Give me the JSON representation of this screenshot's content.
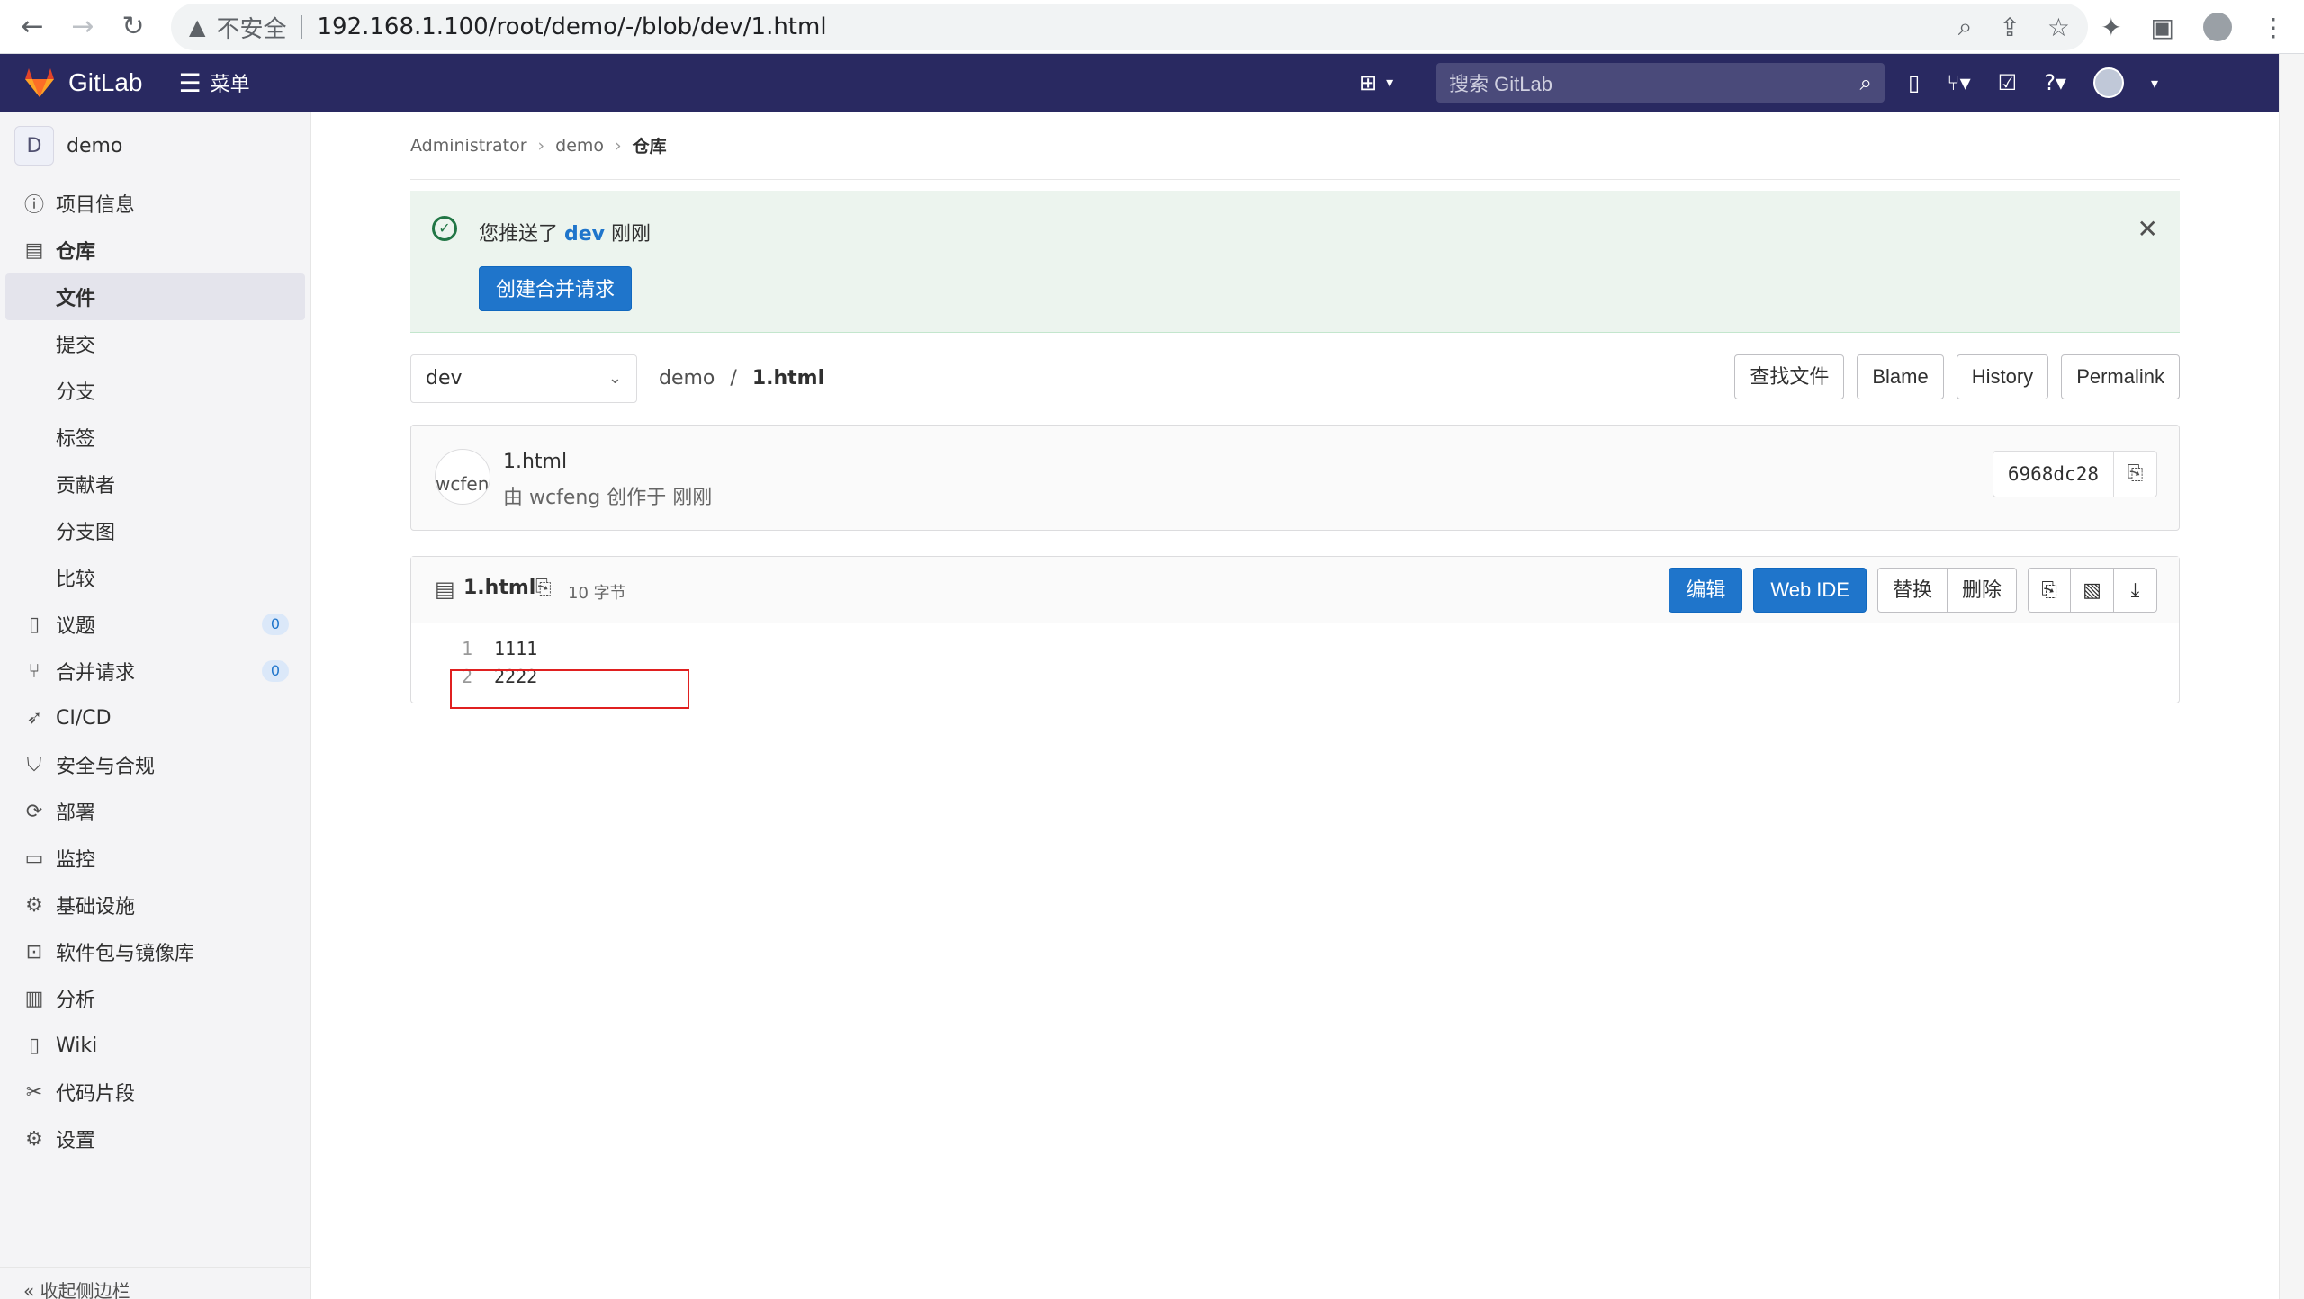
{
  "browser": {
    "insecure_label": "不安全",
    "url": "192.168.1.100/root/demo/-/blob/dev/1.html"
  },
  "topnav": {
    "logo_text": "GitLab",
    "menu_label": "菜单",
    "search_placeholder": "搜索 GitLab"
  },
  "sidebar": {
    "project_initial": "D",
    "project_name": "demo",
    "items": {
      "project_info": "项目信息",
      "repository": "仓库",
      "files": "文件",
      "commits": "提交",
      "branches": "分支",
      "tags": "标签",
      "contributors": "贡献者",
      "graph": "分支图",
      "compare": "比较",
      "issues": "议题",
      "issues_count": "0",
      "merge_requests": "合并请求",
      "merge_requests_count": "0",
      "cicd": "CI/CD",
      "security": "安全与合规",
      "deployments": "部署",
      "monitor": "监控",
      "infrastructure": "基础设施",
      "packages": "软件包与镜像库",
      "analytics": "分析",
      "wiki": "Wiki",
      "snippets": "代码片段",
      "settings": "设置"
    },
    "footer": "收起侧边栏"
  },
  "breadcrumb": {
    "admin": "Administrator",
    "project": "demo",
    "current": "仓库"
  },
  "alert": {
    "msg_prefix": "您推送了",
    "branch": "dev",
    "msg_suffix": "刚刚",
    "button": "创建合并请求"
  },
  "file_bar": {
    "branch": "dev",
    "path_project": "demo",
    "path_sep": "/",
    "file": "1.html",
    "find_file": "查找文件",
    "blame": "Blame",
    "history": "History",
    "permalink": "Permalink"
  },
  "commit": {
    "avatar_alt": "wcfeng",
    "title": "1.html",
    "meta": "由 wcfeng 创作于 刚刚",
    "sha": "6968dc28"
  },
  "blob": {
    "name": "1.html",
    "size": "10 字节",
    "edit": "编辑",
    "web_ide": "Web IDE",
    "replace": "替换",
    "delete": "删除",
    "lines": [
      {
        "n": "1",
        "text": "1111"
      },
      {
        "n": "2",
        "text": "2222"
      }
    ]
  },
  "colors": {
    "nav_bg": "#292961",
    "primary": "#1f75cb",
    "alert_bg": "#ecf4ee",
    "highlight": "#e02020"
  }
}
